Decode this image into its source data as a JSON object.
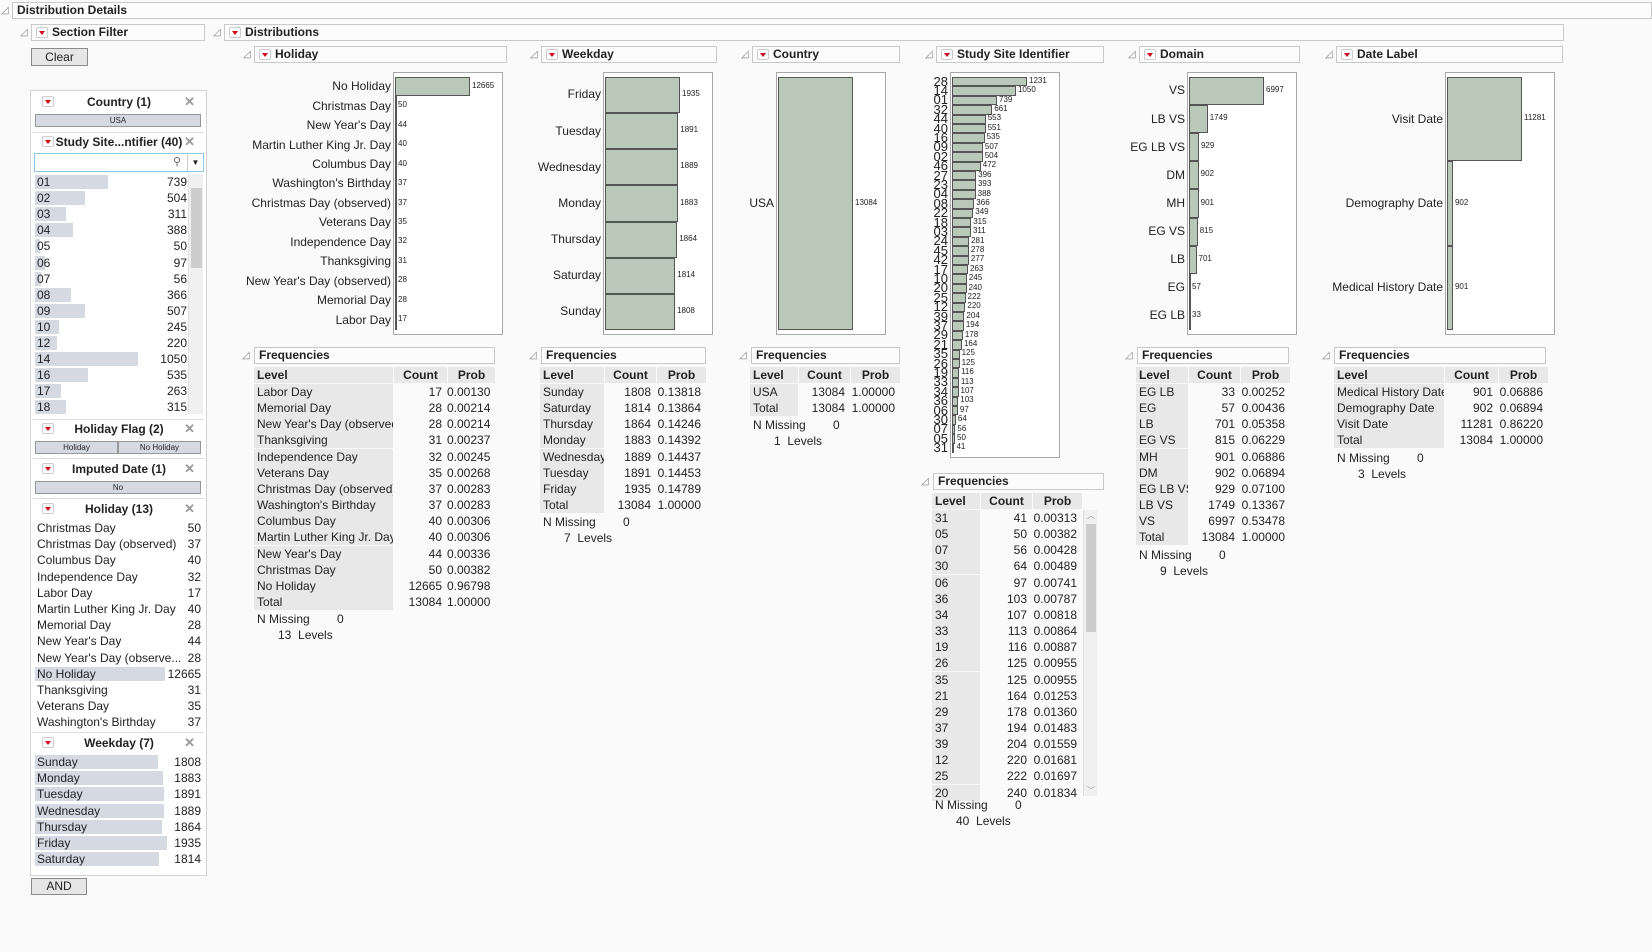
{
  "title": "Distribution Details",
  "section_filter": {
    "title": "Section Filter",
    "clear": "Clear",
    "and": "AND",
    "country": {
      "title": "Country (1)",
      "buttons": [
        "USA"
      ]
    },
    "study_site": {
      "title": "Study Site...ntifier (40)",
      "search_placeholder": "",
      "items": [
        {
          "label": "01",
          "count": 739
        },
        {
          "label": "02",
          "count": 504
        },
        {
          "label": "03",
          "count": 311
        },
        {
          "label": "04",
          "count": 388
        },
        {
          "label": "05",
          "count": 50
        },
        {
          "label": "06",
          "count": 97
        },
        {
          "label": "07",
          "count": 56
        },
        {
          "label": "08",
          "count": 366
        },
        {
          "label": "09",
          "count": 507
        },
        {
          "label": "10",
          "count": 245
        },
        {
          "label": "12",
          "count": 220
        },
        {
          "label": "14",
          "count": 1050
        },
        {
          "label": "16",
          "count": 535
        },
        {
          "label": "17",
          "count": 263
        },
        {
          "label": "18",
          "count": 315
        }
      ],
      "bar_max": 1231
    },
    "holiday_flag": {
      "title": "Holiday Flag (2)",
      "buttons": [
        "Holiday",
        "No Holiday"
      ]
    },
    "imputed_date": {
      "title": "Imputed Date (1)",
      "buttons": [
        "No"
      ]
    },
    "holiday": {
      "title": "Holiday (13)",
      "selected": "No Holiday",
      "items": [
        {
          "label": "Christmas Day",
          "count": 50
        },
        {
          "label": "Christmas Day (observed)",
          "count": 37
        },
        {
          "label": "Columbus Day",
          "count": 40
        },
        {
          "label": "Independence Day",
          "count": 32
        },
        {
          "label": "Labor Day",
          "count": 17
        },
        {
          "label": "Martin Luther King Jr. Day",
          "count": 40
        },
        {
          "label": "Memorial Day",
          "count": 28
        },
        {
          "label": "New Year's Day",
          "count": 44
        },
        {
          "label": "New Year's Day (observe...",
          "count": 28
        },
        {
          "label": "No Holiday",
          "count": 12665
        },
        {
          "label": "Thanksgiving",
          "count": 31
        },
        {
          "label": "Veterans Day",
          "count": 35
        },
        {
          "label": "Washington's Birthday",
          "count": 37
        }
      ]
    },
    "weekday": {
      "title": "Weekday (7)",
      "items": [
        {
          "label": "Sunday",
          "count": 1808
        },
        {
          "label": "Monday",
          "count": 1883
        },
        {
          "label": "Tuesday",
          "count": 1891
        },
        {
          "label": "Wednesday",
          "count": 1889
        },
        {
          "label": "Thursday",
          "count": 1864
        },
        {
          "label": "Friday",
          "count": 1935
        },
        {
          "label": "Saturday",
          "count": 1814
        }
      ]
    }
  },
  "distributions": {
    "title": "Distributions",
    "panels": [
      {
        "title": "Holiday",
        "bars": [
          [
            "No Holiday",
            12665
          ],
          [
            "Christmas Day",
            50
          ],
          [
            "New Year's Day",
            44
          ],
          [
            "Martin Luther King Jr. Day",
            40
          ],
          [
            "Columbus Day",
            40
          ],
          [
            "Washington's Birthday",
            37
          ],
          [
            "Christmas Day (observed)",
            37
          ],
          [
            "Veterans Day",
            35
          ],
          [
            "Independence Day",
            32
          ],
          [
            "Thanksgiving",
            31
          ],
          [
            "New Year's Day (observed)",
            28
          ],
          [
            "Memorial Day",
            28
          ],
          [
            "Labor Day",
            17
          ]
        ],
        "freq": {
          "title": "Frequencies",
          "headers": [
            "Level",
            "Count",
            "Prob"
          ],
          "rows": [
            [
              "Labor Day",
              "17",
              "0.00130"
            ],
            [
              "Memorial Day",
              "28",
              "0.00214"
            ],
            [
              "New Year's Day (observed)",
              "28",
              "0.00214"
            ],
            [
              "Thanksgiving",
              "31",
              "0.00237"
            ],
            [
              "Independence Day",
              "32",
              "0.00245"
            ],
            [
              "Veterans Day",
              "35",
              "0.00268"
            ],
            [
              "Christmas Day (observed)",
              "37",
              "0.00283"
            ],
            [
              "Washington's Birthday",
              "37",
              "0.00283"
            ],
            [
              "Columbus Day",
              "40",
              "0.00306"
            ],
            [
              "Martin Luther King Jr. Day",
              "40",
              "0.00306"
            ],
            [
              "New Year's Day",
              "44",
              "0.00336"
            ],
            [
              "Christmas Day",
              "50",
              "0.00382"
            ],
            [
              "No Holiday",
              "12665",
              "0.96798"
            ],
            [
              "Total",
              "13084",
              "1.00000"
            ]
          ],
          "n_missing_label": "N Missing",
          "n_missing": "0",
          "levels": "13  Levels"
        }
      },
      {
        "title": "Weekday",
        "bars": [
          [
            "Friday",
            1935
          ],
          [
            "Tuesday",
            1891
          ],
          [
            "Wednesday",
            1889
          ],
          [
            "Monday",
            1883
          ],
          [
            "Thursday",
            1864
          ],
          [
            "Saturday",
            1814
          ],
          [
            "Sunday",
            1808
          ]
        ],
        "freq": {
          "title": "Frequencies",
          "headers": [
            "Level",
            "Count",
            "Prob"
          ],
          "rows": [
            [
              "Sunday",
              "1808",
              "0.13818"
            ],
            [
              "Saturday",
              "1814",
              "0.13864"
            ],
            [
              "Thursday",
              "1864",
              "0.14246"
            ],
            [
              "Monday",
              "1883",
              "0.14392"
            ],
            [
              "Wednesday",
              "1889",
              "0.14437"
            ],
            [
              "Tuesday",
              "1891",
              "0.14453"
            ],
            [
              "Friday",
              "1935",
              "0.14789"
            ],
            [
              "Total",
              "13084",
              "1.00000"
            ]
          ],
          "n_missing_label": "N Missing",
          "n_missing": "0",
          "levels": "7  Levels"
        }
      },
      {
        "title": "Country",
        "bars": [
          [
            "USA",
            13084
          ]
        ],
        "freq": {
          "title": "Frequencies",
          "headers": [
            "Level",
            "Count",
            "Prob"
          ],
          "rows": [
            [
              "USA",
              "13084",
              "1.00000"
            ],
            [
              "Total",
              "13084",
              "1.00000"
            ]
          ],
          "n_missing_label": "N Missing",
          "n_missing": "0",
          "levels": "1  Levels"
        }
      },
      {
        "title": "Study Site Identifier",
        "bars": [
          [
            "28",
            1231
          ],
          [
            "14",
            1050
          ],
          [
            "01",
            739
          ],
          [
            "32",
            661
          ],
          [
            "44",
            553
          ],
          [
            "40",
            551
          ],
          [
            "16",
            535
          ],
          [
            "09",
            507
          ],
          [
            "02",
            504
          ],
          [
            "46",
            472
          ],
          [
            "27",
            396
          ],
          [
            "23",
            393
          ],
          [
            "04",
            388
          ],
          [
            "08",
            366
          ],
          [
            "22",
            349
          ],
          [
            "18",
            315
          ],
          [
            "03",
            311
          ],
          [
            "24",
            281
          ],
          [
            "45",
            278
          ],
          [
            "42",
            277
          ],
          [
            "17",
            263
          ],
          [
            "10",
            245
          ],
          [
            "20",
            240
          ],
          [
            "25",
            222
          ],
          [
            "12",
            220
          ],
          [
            "39",
            204
          ],
          [
            "37",
            194
          ],
          [
            "29",
            178
          ],
          [
            "21",
            164
          ],
          [
            "35",
            125
          ],
          [
            "26",
            125
          ],
          [
            "19",
            116
          ],
          [
            "33",
            113
          ],
          [
            "34",
            107
          ],
          [
            "36",
            103
          ],
          [
            "06",
            97
          ],
          [
            "30",
            64
          ],
          [
            "07",
            56
          ],
          [
            "05",
            50
          ],
          [
            "31",
            41
          ]
        ],
        "freq": {
          "title": "Frequencies",
          "headers": [
            "Level",
            "Count",
            "Prob"
          ],
          "rows": [
            [
              "31",
              "41",
              "0.00313"
            ],
            [
              "05",
              "50",
              "0.00382"
            ],
            [
              "07",
              "56",
              "0.00428"
            ],
            [
              "30",
              "64",
              "0.00489"
            ],
            [
              "06",
              "97",
              "0.00741"
            ],
            [
              "36",
              "103",
              "0.00787"
            ],
            [
              "34",
              "107",
              "0.00818"
            ],
            [
              "33",
              "113",
              "0.00864"
            ],
            [
              "19",
              "116",
              "0.00887"
            ],
            [
              "26",
              "125",
              "0.00955"
            ],
            [
              "35",
              "125",
              "0.00955"
            ],
            [
              "21",
              "164",
              "0.01253"
            ],
            [
              "29",
              "178",
              "0.01360"
            ],
            [
              "37",
              "194",
              "0.01483"
            ],
            [
              "39",
              "204",
              "0.01559"
            ],
            [
              "12",
              "220",
              "0.01681"
            ],
            [
              "25",
              "222",
              "0.01697"
            ],
            [
              "20",
              "240",
              "0.01834"
            ]
          ],
          "n_missing_label": "N Missing",
          "n_missing": "0",
          "levels": "40  Levels"
        }
      },
      {
        "title": "Domain",
        "bars": [
          [
            "VS",
            6997
          ],
          [
            "LB VS",
            1749
          ],
          [
            "EG LB VS",
            929
          ],
          [
            "DM",
            902
          ],
          [
            "MH",
            901
          ],
          [
            "EG VS",
            815
          ],
          [
            "LB",
            701
          ],
          [
            "EG",
            57
          ],
          [
            "EG LB",
            33
          ]
        ],
        "freq": {
          "title": "Frequencies",
          "headers": [
            "Level",
            "Count",
            "Prob"
          ],
          "rows": [
            [
              "EG LB",
              "33",
              "0.00252"
            ],
            [
              "EG",
              "57",
              "0.00436"
            ],
            [
              "LB",
              "701",
              "0.05358"
            ],
            [
              "EG VS",
              "815",
              "0.06229"
            ],
            [
              "MH",
              "901",
              "0.06886"
            ],
            [
              "DM",
              "902",
              "0.06894"
            ],
            [
              "EG LB VS",
              "929",
              "0.07100"
            ],
            [
              "LB VS",
              "1749",
              "0.13367"
            ],
            [
              "VS",
              "6997",
              "0.53478"
            ],
            [
              "Total",
              "13084",
              "1.00000"
            ]
          ],
          "n_missing_label": "N Missing",
          "n_missing": "0",
          "levels": "9  Levels"
        }
      },
      {
        "title": "Date Label",
        "bars": [
          [
            "Visit Date",
            11281
          ],
          [
            "Demography Date",
            902
          ],
          [
            "Medical History Date",
            901
          ]
        ],
        "freq": {
          "title": "Frequencies",
          "headers": [
            "Level",
            "Count",
            "Prob"
          ],
          "rows": [
            [
              "Medical History Date",
              "901",
              "0.06886"
            ],
            [
              "Demography Date",
              "902",
              "0.06894"
            ],
            [
              "Visit Date",
              "11281",
              "0.86220"
            ],
            [
              "Total",
              "13084",
              "1.00000"
            ]
          ],
          "n_missing_label": "N Missing",
          "n_missing": "0",
          "levels": "3  Levels"
        }
      }
    ]
  }
}
